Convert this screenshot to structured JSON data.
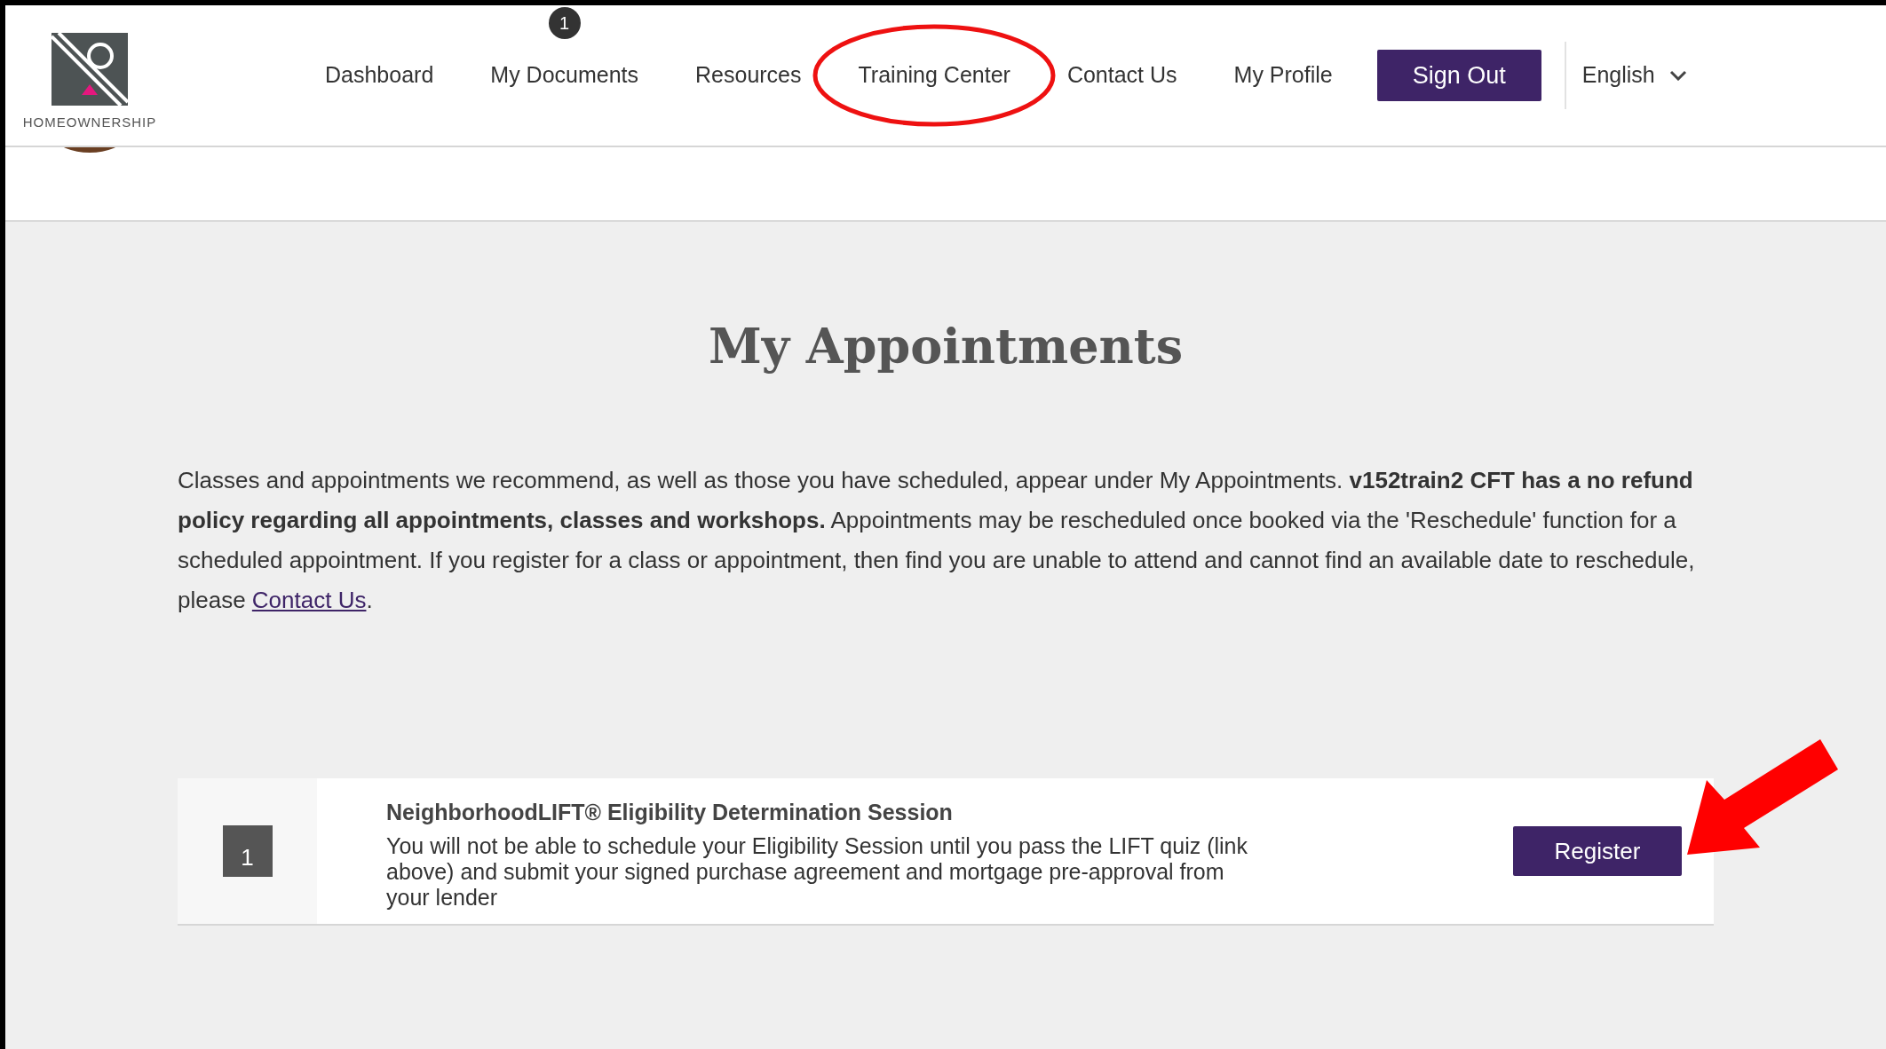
{
  "logo": {
    "text": "HOMEOWNERSHIP"
  },
  "nav": [
    {
      "label": "Dashboard"
    },
    {
      "label": "My Documents",
      "badge": "1"
    },
    {
      "label": "Resources"
    },
    {
      "label": "Training Center",
      "circled": true
    },
    {
      "label": "Contact Us"
    },
    {
      "label": "My Profile"
    }
  ],
  "sign_out": "Sign Out",
  "language": "English",
  "title": "My Appointments",
  "intro": "Classes and appointments we recommend, as well as those you have scheduled, appear under My Appointments. **v152train2 CFT has a no refund policy regarding all appointments, classes and workshops.** Appointments may be rescheduled once booked via the 'Reschedule' function for a scheduled appointment. If you register for a class or appointment, then find you are unable to attend and cannot find an available date to reschedule, please ",
  "intro_link": "Contact Us",
  "intro_end": ".",
  "appointments": [
    {
      "day": "1",
      "title": "NeighborhoodLIFT® Eligibility Determination Session",
      "description": "You will not be able to schedule your Eligibility Session until you pass the LIFT quiz (link above) and submit your signed purchase agreement and mortgage pre-approval from your lender",
      "action": "Register",
      "arrow": true
    }
  ]
}
